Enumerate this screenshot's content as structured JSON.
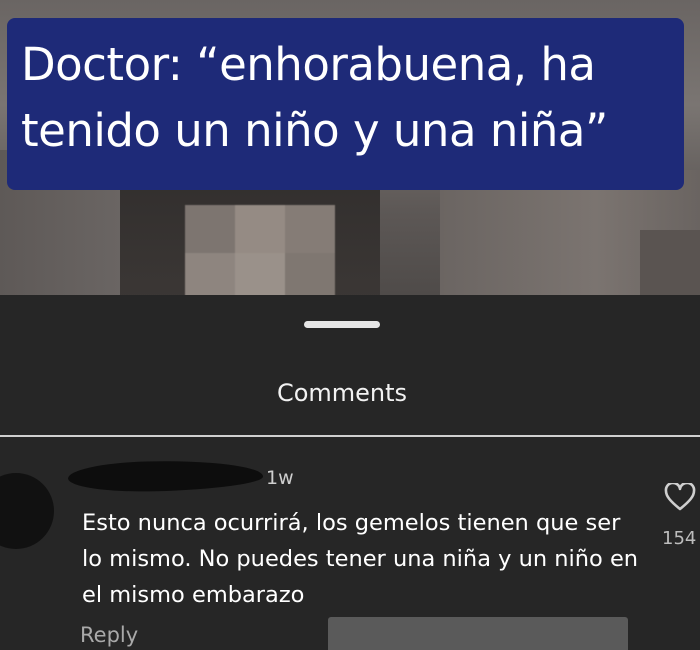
{
  "video": {
    "caption": "Doctor: “enhorabuena, ha tenido un niño y una niña”"
  },
  "comments_sheet": {
    "title": "Comments",
    "comments": [
      {
        "time_ago": "1w",
        "text": "Esto nunca ocurrirá, los gemelos tienen que ser lo mismo. No puedes tener una niña y un niño en el mismo embarazo",
        "like_count": "154",
        "reply_label": "Reply",
        "like_icon": "heart-outline-icon"
      }
    ]
  },
  "colors": {
    "caption_background": "#1e2a78",
    "sheet_background": "#262626",
    "text_primary": "#ffffff",
    "text_secondary": "#a9a9a9"
  }
}
